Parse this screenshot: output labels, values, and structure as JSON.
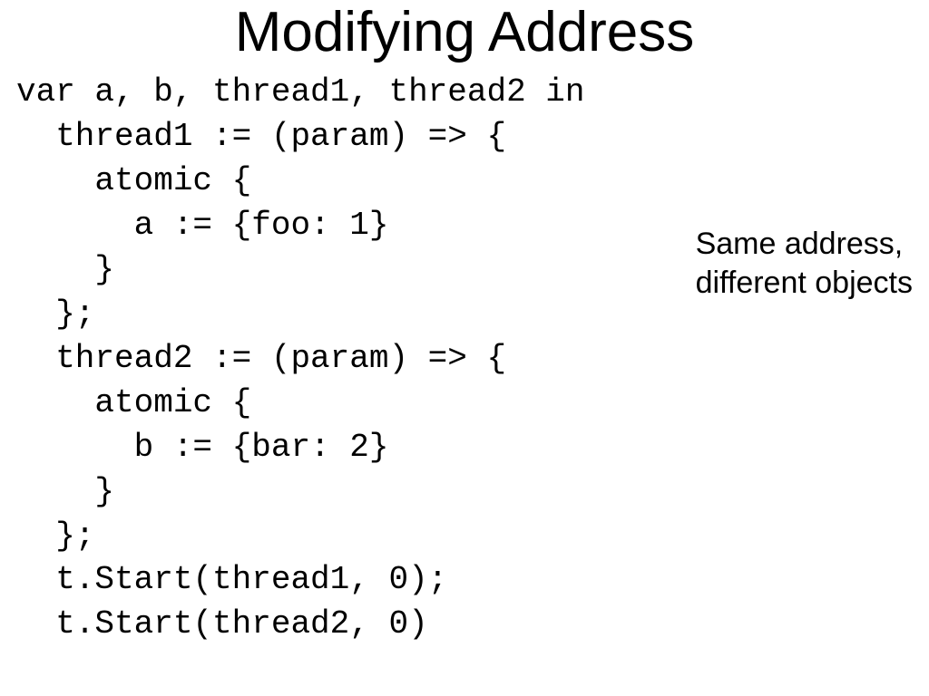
{
  "title": "Modifying Address",
  "code": {
    "l1": "var a, b, thread1, thread2 in",
    "l2": "  thread1 := (param) => {",
    "l3": "    atomic {",
    "l4": "      a := {foo: 1}",
    "l5": "    }",
    "l6": "  };",
    "l7": "  thread2 := (param) => {",
    "l8": "    atomic {",
    "l9": "      b := {bar: 2}",
    "l10": "    }",
    "l11": "  };",
    "l12": "  t.Start(thread1, 0);",
    "l13": "  t.Start(thread2, 0)"
  },
  "annotation": {
    "line1": "Same address,",
    "line2": "different objects"
  }
}
